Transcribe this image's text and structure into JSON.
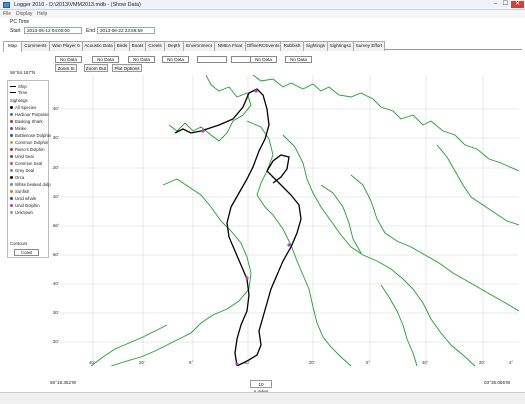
{
  "window": {
    "title": "Logger 2010 - D:\\2013\\VMM2013.mdb - (Show Data)",
    "minimize": "–",
    "maximize": "☐",
    "close": "✕"
  },
  "menu": [
    "File",
    "Display",
    "Help"
  ],
  "time": {
    "section_label": "PC Time",
    "start_label": "Start",
    "start_value": "2013-06-12 04:00:00",
    "end_label": "End",
    "end_value": "2013-06-22 23:59:59"
  },
  "tabs": [
    "Map",
    "Comments",
    "Wan Player 0",
    "Acoustic Data",
    "Birds",
    "Boats",
    "Creels",
    "Depth",
    "Environment",
    "NMEA Float",
    "OffineRCEvents",
    "Rubbish",
    "Sightings",
    "Sightings1",
    "Survey Effort"
  ],
  "nodata_label": "No Data",
  "map_buttons": [
    "Zoom In",
    "Zoom Out",
    "Plot Options"
  ],
  "top_lat": "56°54.187'N",
  "bottom_lat": "56°18.352'W",
  "bottom_right": "03°36.055'W",
  "scale_label": "10 n.miles",
  "legend": {
    "items": [
      {
        "label": "Ship",
        "kind": "line",
        "color": "#000000"
      },
      {
        "label": "Time",
        "kind": "line",
        "color": "#000000"
      },
      {
        "label": "Sightings",
        "kind": "none",
        "color": "#000000"
      },
      {
        "label": "All Species",
        "kind": "dot",
        "color": "#000000"
      },
      {
        "label": "Harbour Porpoise",
        "kind": "dot",
        "color": "#2e8b57"
      },
      {
        "label": "Basking Shark",
        "kind": "dot",
        "color": "#b03a2e"
      },
      {
        "label": "Minke",
        "kind": "dot",
        "color": "#7b3fa0"
      },
      {
        "label": "Bottlenose Dolphin",
        "kind": "dot",
        "color": "#1f5fa8"
      },
      {
        "label": "Common Dolphin",
        "kind": "dot",
        "color": "#d4a017"
      },
      {
        "label": "Risso's Dolphin",
        "kind": "dot",
        "color": "#c03030"
      },
      {
        "label": "Unid Seal",
        "kind": "dot",
        "color": "#6a4a2a"
      },
      {
        "label": "Common Seal",
        "kind": "dot",
        "color": "#d9534f"
      },
      {
        "label": "Grey Seal",
        "kind": "dot",
        "color": "#8a8a8a"
      },
      {
        "label": "Orca",
        "kind": "dot",
        "color": "#111111"
      },
      {
        "label": "White beaked dolp.",
        "kind": "dot",
        "color": "#3c9fd9"
      },
      {
        "label": "Sunfish",
        "kind": "dot",
        "color": "#e07b22"
      },
      {
        "label": "Unid whale",
        "kind": "dot",
        "color": "#5a2d82"
      },
      {
        "label": "Unid Dolphin",
        "kind": "dot",
        "color": "#cc3399"
      },
      {
        "label": "Unknown",
        "kind": "dot",
        "color": "#999999"
      },
      {
        "label": "Contours",
        "kind": "none",
        "color": "#000000"
      }
    ],
    "contour_value": "Coast"
  },
  "lat_ticks": [
    "40'",
    "30'",
    "20'",
    "10'",
    "56°",
    "50'",
    "40'",
    "30'",
    "20'"
  ],
  "lon_ticks": [
    "40'",
    "20'",
    "6°",
    "40'",
    "20'",
    "5°",
    "40'",
    "20'",
    "4°"
  ],
  "colors": {
    "track": "#000000",
    "coast": "#1f9e2a",
    "grid": "#d8d8d8",
    "sighting": "#cc33cc"
  }
}
